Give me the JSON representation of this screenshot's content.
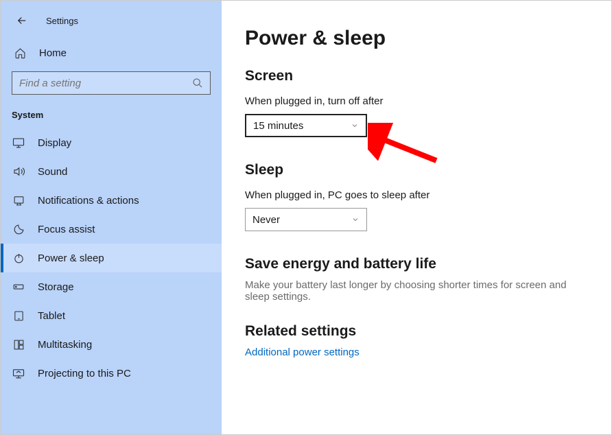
{
  "app": {
    "title": "Settings"
  },
  "sidebar": {
    "home_label": "Home",
    "search_placeholder": "Find a setting",
    "category": "System",
    "items": [
      {
        "label": "Display"
      },
      {
        "label": "Sound"
      },
      {
        "label": "Notifications & actions"
      },
      {
        "label": "Focus assist"
      },
      {
        "label": "Power & sleep"
      },
      {
        "label": "Storage"
      },
      {
        "label": "Tablet"
      },
      {
        "label": "Multitasking"
      },
      {
        "label": "Projecting to this PC"
      }
    ]
  },
  "page": {
    "title": "Power & sleep",
    "screen": {
      "heading": "Screen",
      "field_label": "When plugged in, turn off after",
      "value": "15 minutes"
    },
    "sleep": {
      "heading": "Sleep",
      "field_label": "When plugged in, PC goes to sleep after",
      "value": "Never"
    },
    "save_energy": {
      "heading": "Save energy and battery life",
      "description": "Make your battery last longer by choosing shorter times for screen and sleep settings."
    },
    "related": {
      "heading": "Related settings",
      "link": "Additional power settings"
    }
  }
}
